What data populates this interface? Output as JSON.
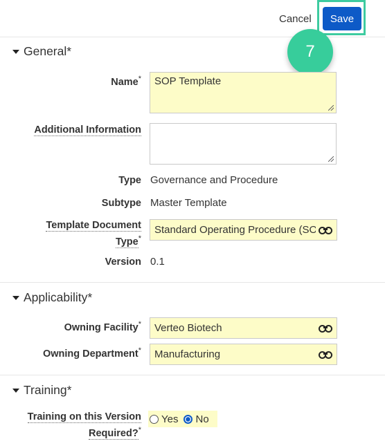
{
  "toolbar": {
    "cancel_label": "Cancel",
    "save_label": "Save"
  },
  "step_badge": "7",
  "sections": {
    "general": "General*",
    "applicability": "Applicability*",
    "training": "Training*"
  },
  "general": {
    "name": {
      "label": "Name",
      "required_mark": "*",
      "value": "SOP Template"
    },
    "additional_info": {
      "label": "Additional Information",
      "value": ""
    },
    "type": {
      "label": "Type",
      "value": "Governance and Procedure"
    },
    "subtype": {
      "label": "Subtype",
      "value": "Master Template"
    },
    "template_doc_type": {
      "label_line1": "Template Document",
      "label_line2": "Type",
      "required_mark": "*",
      "value": "Standard Operating Procedure (SOP)"
    },
    "version": {
      "label": "Version",
      "value": "0.1"
    }
  },
  "applicability": {
    "owning_facility": {
      "label": "Owning Facility",
      "required_mark": "*",
      "value": "Verteo Biotech"
    },
    "owning_department": {
      "label": "Owning Department",
      "required_mark": "*",
      "value": "Manufacturing"
    }
  },
  "training": {
    "required": {
      "label_line1": "Training on this Version",
      "label_line2": "Required?",
      "required_mark": "*",
      "option_yes": "Yes",
      "option_no": "No",
      "selected": "No"
    }
  },
  "colors": {
    "accent": "#0d5ac7",
    "highlight": "#3ecba0",
    "required_field_bg": "#fdfcc8"
  }
}
